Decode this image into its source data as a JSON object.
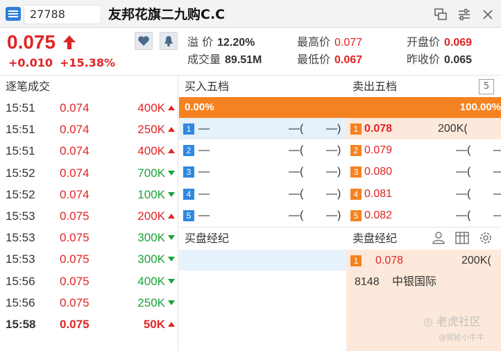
{
  "header": {
    "code": "27788",
    "name": "友邦花旗二九购C.C"
  },
  "icons": {
    "menu": "menu-icon",
    "popout": "popout-icon",
    "settings": "settings-icon",
    "close": "close-icon",
    "favorite": "heart-icon",
    "alert": "bell-icon",
    "five_levels": "5",
    "broker_person": "person-icon",
    "broker_columns": "columns-icon",
    "broker_settings": "gear-icon"
  },
  "quote": {
    "price": "0.075",
    "change": "+0.010",
    "change_pct": "+15.38%",
    "premium_label": "溢  价",
    "premium": "12.20%",
    "volume_label": "成交量",
    "volume": "89.51M",
    "high_label": "最高价",
    "high": "0.077",
    "low_label": "最低价",
    "low": "0.067",
    "open_label": "开盘价",
    "open": "0.069",
    "prev_close_label": "昨收价",
    "prev_close": "0.065"
  },
  "colors": {
    "up": "#e02424",
    "down": "#1aa23a",
    "accent_orange": "#f58220",
    "accent_blue": "#2f88e0"
  },
  "trades": {
    "title": "逐笔成交",
    "rows": [
      {
        "time": "15:51",
        "price": "0.074",
        "volume": "400K",
        "dir": "up"
      },
      {
        "time": "15:51",
        "price": "0.074",
        "volume": "250K",
        "dir": "up"
      },
      {
        "time": "15:51",
        "price": "0.074",
        "volume": "400K",
        "dir": "up"
      },
      {
        "time": "15:52",
        "price": "0.074",
        "volume": "700K",
        "dir": "down"
      },
      {
        "time": "15:52",
        "price": "0.074",
        "volume": "100K",
        "dir": "down"
      },
      {
        "time": "15:53",
        "price": "0.075",
        "volume": "200K",
        "dir": "up"
      },
      {
        "time": "15:53",
        "price": "0.075",
        "volume": "300K",
        "dir": "down"
      },
      {
        "time": "15:53",
        "price": "0.075",
        "volume": "300K",
        "dir": "down"
      },
      {
        "time": "15:56",
        "price": "0.075",
        "volume": "400K",
        "dir": "down"
      },
      {
        "time": "15:56",
        "price": "0.075",
        "volume": "250K",
        "dir": "down"
      },
      {
        "time": "15:58",
        "price": "0.075",
        "volume": "50K",
        "dir": "up"
      }
    ]
  },
  "orderbook": {
    "buy_title": "买入五档",
    "sell_title": "卖出五档",
    "buy_ratio": "0.00%",
    "sell_ratio": "100.00%",
    "buy": [
      {
        "level": "1",
        "price": "—",
        "volume": "—(",
        "count": "—)"
      },
      {
        "level": "2",
        "price": "—",
        "volume": "—(",
        "count": "—)"
      },
      {
        "level": "3",
        "price": "—",
        "volume": "—(",
        "count": "—)"
      },
      {
        "level": "4",
        "price": "—",
        "volume": "—(",
        "count": "—)"
      },
      {
        "level": "5",
        "price": "—",
        "volume": "—(",
        "count": "—)"
      }
    ],
    "sell": [
      {
        "level": "1",
        "price": "0.078",
        "volume": "200K("
      },
      {
        "level": "2",
        "price": "0.079",
        "volume": "—(",
        "count": "—"
      },
      {
        "level": "3",
        "price": "0.080",
        "volume": "—(",
        "count": "—"
      },
      {
        "level": "4",
        "price": "0.081",
        "volume": "—(",
        "count": "—"
      },
      {
        "level": "5",
        "price": "0.082",
        "volume": "—(",
        "count": "—"
      }
    ]
  },
  "brokers": {
    "buy_title": "买盘经纪",
    "sell_title": "卖盘经纪",
    "sell_level": "1",
    "sell_price": "0.078",
    "sell_volume": "200K(",
    "sell_broker_code": "8148",
    "sell_broker_name": "中银国际"
  },
  "watermark": {
    "line1": "老虎社区",
    "line2": "@冥轮小牛牛"
  }
}
